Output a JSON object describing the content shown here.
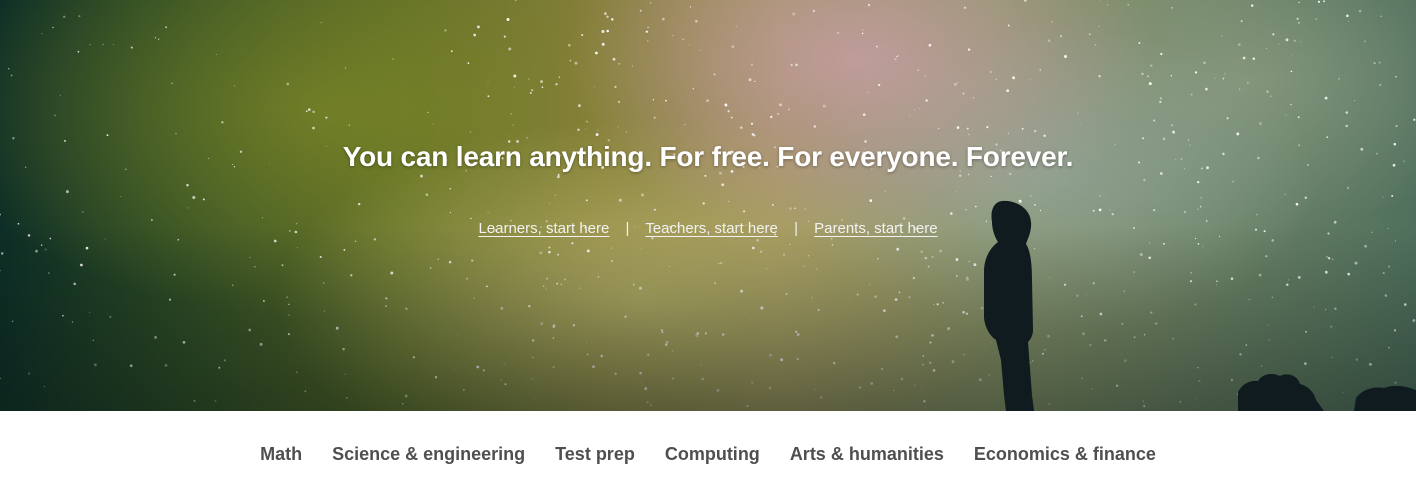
{
  "hero": {
    "tagline": "You can learn anything. For free. For everyone. Forever.",
    "links": [
      {
        "label": "Learners, start here"
      },
      {
        "label": "Teachers, start here"
      },
      {
        "label": "Parents, start here"
      }
    ],
    "separator": "|"
  },
  "subjects": [
    {
      "label": "Math"
    },
    {
      "label": "Science & engineering"
    },
    {
      "label": "Test prep"
    },
    {
      "label": "Computing"
    },
    {
      "label": "Arts & humanities"
    },
    {
      "label": "Economics & finance"
    }
  ],
  "colors": {
    "tagline": "#ffffff",
    "nav_text": "#4f4f4f",
    "nav_bg": "#ffffff"
  }
}
